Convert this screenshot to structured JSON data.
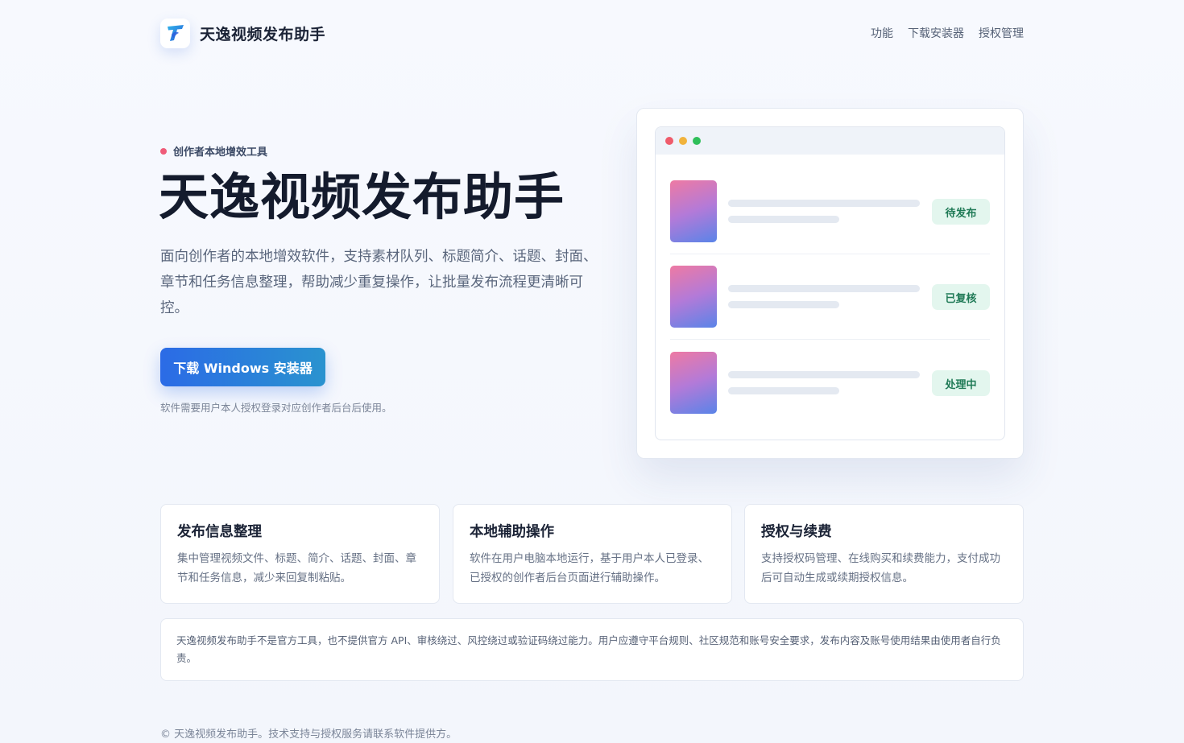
{
  "header": {
    "brand_name": "天逸视频发布助手",
    "logo_icon": "feather-t-logo-icon",
    "nav": [
      {
        "label": "功能"
      },
      {
        "label": "下载安装器"
      },
      {
        "label": "授权管理"
      }
    ]
  },
  "hero": {
    "eyebrow": "创作者本地增效工具",
    "title": "天逸视频发布助手",
    "description": "面向创作者的本地增效软件，支持素材队列、标题简介、话题、封面、章节和任务信息整理，帮助减少重复操作，让批量发布流程更清晰可控。",
    "cta_label": "下载 Windows 安装器",
    "cta_note": "软件需要用户本人授权登录对应创作者后台后使用。"
  },
  "preview": {
    "window_dots": [
      "#ef5b6b",
      "#f1b33c",
      "#2fbf5a"
    ],
    "rows": [
      {
        "status": "待发布"
      },
      {
        "status": "已复核"
      },
      {
        "status": "处理中"
      }
    ]
  },
  "features": [
    {
      "title": "发布信息整理",
      "text": "集中管理视频文件、标题、简介、话题、封面、章节和任务信息，减少来回复制粘贴。"
    },
    {
      "title": "本地辅助操作",
      "text": "软件在用户电脑本地运行，基于用户本人已登录、已授权的创作者后台页面进行辅助操作。"
    },
    {
      "title": "授权与续费",
      "text": "支持授权码管理、在线购买和续费能力，支付成功后可自动生成或续期授权信息。"
    }
  ],
  "disclaimer": "天逸视频发布助手不是官方工具，也不提供官方 API、审核绕过、风控绕过或验证码绕过能力。用户应遵守平台规则、社区规范和账号安全要求，发布内容及账号使用结果由使用者自行负责。",
  "footer": "© 天逸视频发布助手。技术支持与授权服务请联系软件提供方。"
}
